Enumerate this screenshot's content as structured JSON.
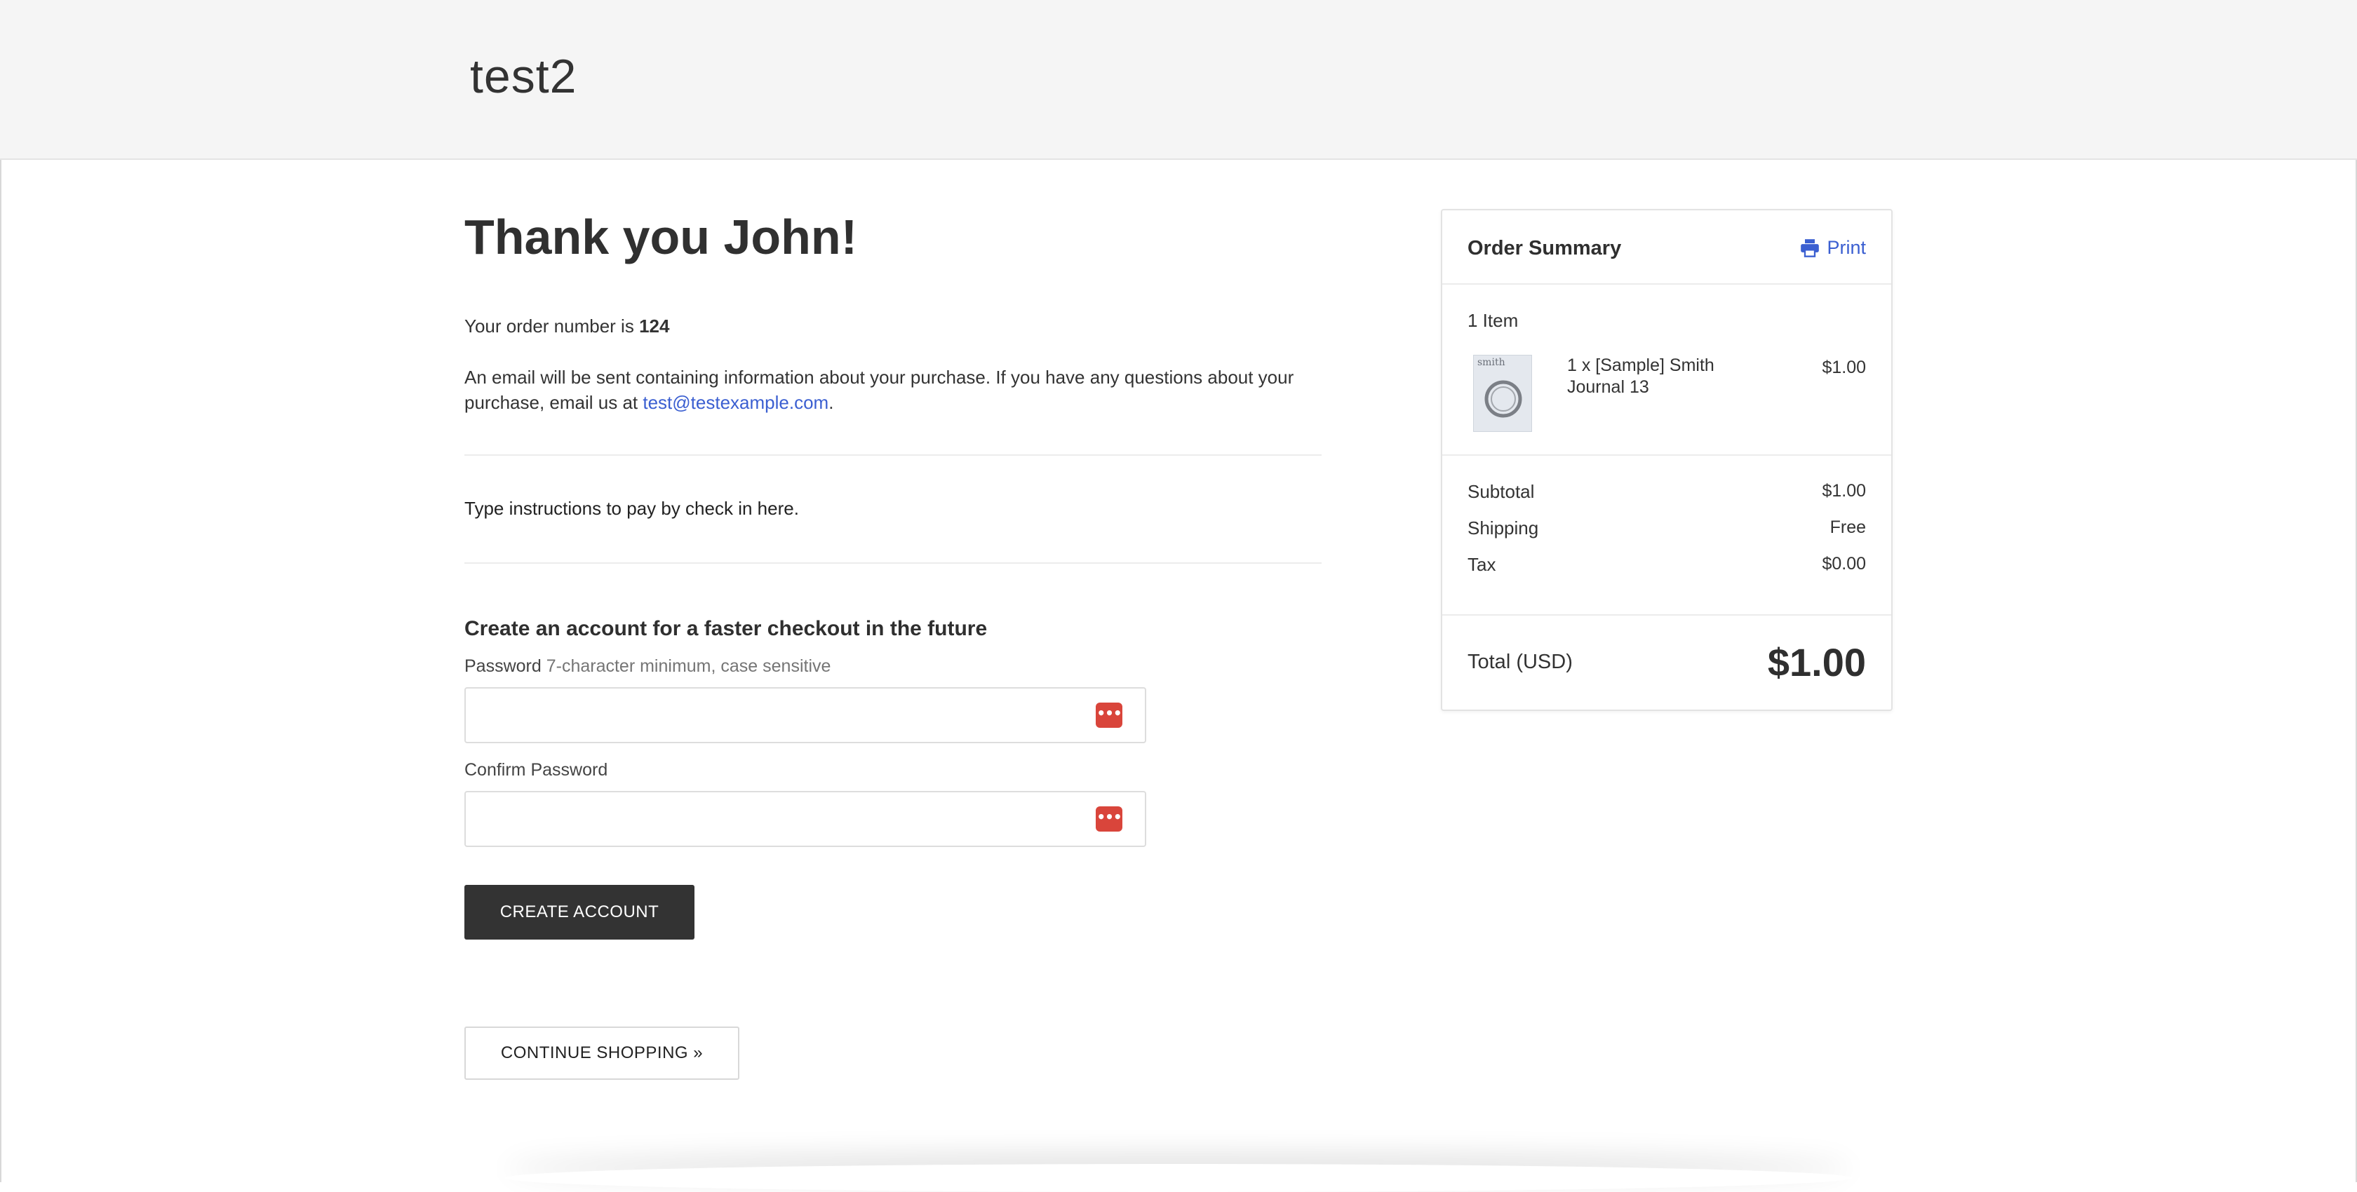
{
  "header": {
    "store_name": "test2"
  },
  "confirmation": {
    "heading": "Thank you John!",
    "order_prefix": "Your order number is ",
    "order_number": "124",
    "email_text_before": "An email will be sent containing information about your purchase. If you have any questions about your purchase, email us at ",
    "email_address": "test@testexample.com",
    "email_text_after": ".",
    "check_instructions": "Type instructions to pay by check in here."
  },
  "account": {
    "title": "Create an account for a faster checkout in the future",
    "password_label": "Password",
    "password_hint": "7-character minimum, case sensitive",
    "password_value": "",
    "confirm_label": "Confirm Password",
    "confirm_value": "",
    "password_manager_icon": "password-manager-icon",
    "create_button": "CREATE ACCOUNT"
  },
  "continue_button": "CONTINUE SHOPPING »",
  "summary": {
    "title": "Order Summary",
    "print_label": "Print",
    "print_icon": "printer-icon",
    "item_count": "1 Item",
    "items": [
      {
        "name": "1 x [Sample] Smith Journal 13",
        "price": "$1.00",
        "thumb_text": "smith"
      }
    ],
    "subtotal_label": "Subtotal",
    "subtotal_value": "$1.00",
    "shipping_label": "Shipping",
    "shipping_value": "Free",
    "tax_label": "Tax",
    "tax_value": "$0.00",
    "total_label": "Total (USD)",
    "total_value": "$1.00"
  },
  "colors": {
    "link": "#3b5fd1",
    "button_dark": "#333333",
    "password_icon": "#d9453b"
  }
}
